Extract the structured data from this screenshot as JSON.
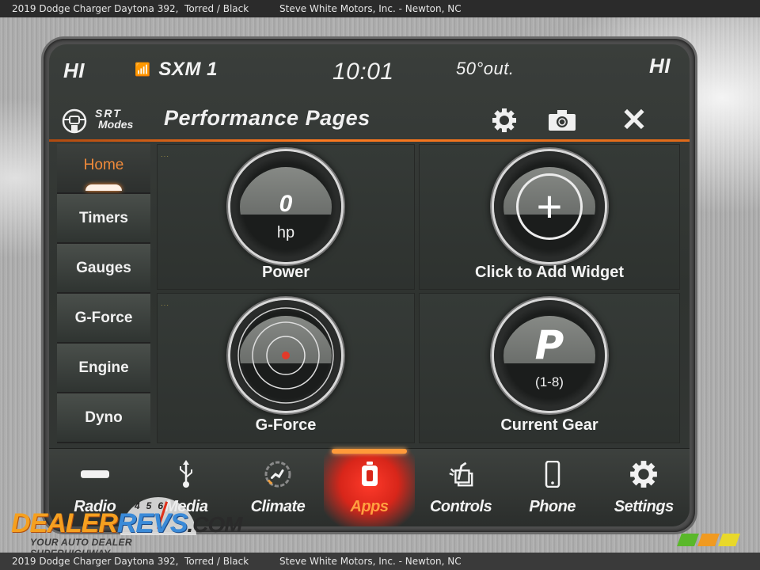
{
  "caption": {
    "vehicle": "2019 Dodge Charger Daytona 392,  Torred / Black",
    "dealer": "Steve White Motors, Inc. - Newton, NC"
  },
  "status_bar": {
    "left_temp_setting": "HI",
    "right_temp_setting": "HI",
    "radio_icon": "antenna-icon",
    "radio_station": "SXM 1",
    "clock": "10:01",
    "outside_temp": "50°out."
  },
  "title_bar": {
    "srt_logo_top": "SRT",
    "srt_logo_bottom": "Modes",
    "title": "Performance Pages",
    "actions": [
      {
        "icon": "gear-icon",
        "label": "Settings"
      },
      {
        "icon": "camera-icon",
        "label": "Screenshot"
      },
      {
        "icon": "close-icon",
        "label": "✕"
      }
    ],
    "accent_color": "#ff7a20"
  },
  "sidebar": {
    "active": "Home",
    "items": [
      {
        "label": "Home"
      },
      {
        "label": "Timers"
      },
      {
        "label": "Gauges"
      },
      {
        "label": "G-Force"
      },
      {
        "label": "Engine"
      },
      {
        "label": "Dyno"
      }
    ]
  },
  "widgets": {
    "power": {
      "value": "0",
      "unit": "hp",
      "label": "Power"
    },
    "add": {
      "symbol": "+",
      "label": "Click to Add Widget"
    },
    "gforce": {
      "label": "G-Force"
    },
    "gear": {
      "value": "P",
      "range": "(1-8)",
      "label": "Current Gear"
    },
    "dots": "···"
  },
  "bottom_nav": {
    "active": "Apps",
    "active_color": "#ffa040",
    "items": [
      {
        "icon": "radio-icon",
        "label": "Radio"
      },
      {
        "icon": "usb-icon",
        "label": "Media"
      },
      {
        "icon": "climate-icon",
        "label": "Climate"
      },
      {
        "icon": "apps-icon",
        "label": "Apps"
      },
      {
        "icon": "controls-icon",
        "label": "Controls"
      },
      {
        "icon": "phone-icon",
        "label": "Phone"
      },
      {
        "icon": "settings-icon",
        "label": "Settings"
      }
    ]
  },
  "watermark": {
    "brand_part1": "DEALER",
    "brand_part2": "REVS",
    "brand_part3": ".COM",
    "tagline": "YOUR AUTO DEALER SUPERHIGHWAY",
    "gauge_numbers": "456"
  }
}
